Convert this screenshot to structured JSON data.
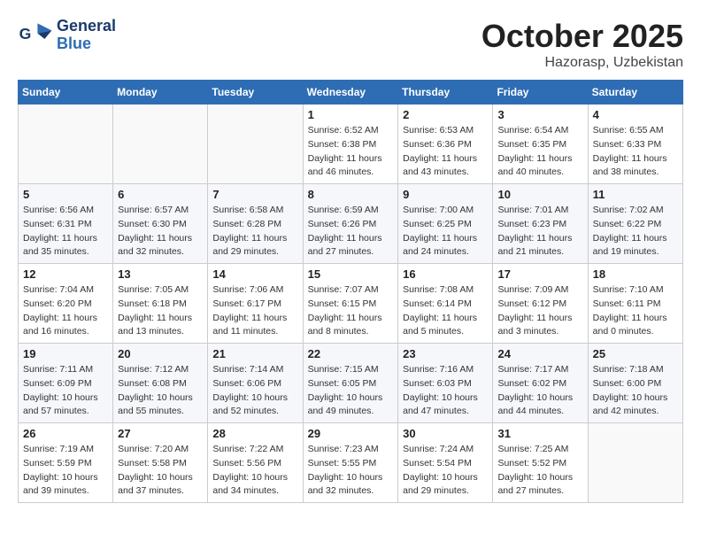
{
  "header": {
    "logo_general": "General",
    "logo_blue": "Blue",
    "month": "October 2025",
    "location": "Hazorasp, Uzbekistan"
  },
  "weekdays": [
    "Sunday",
    "Monday",
    "Tuesday",
    "Wednesday",
    "Thursday",
    "Friday",
    "Saturday"
  ],
  "weeks": [
    [
      {
        "day": "",
        "info": ""
      },
      {
        "day": "",
        "info": ""
      },
      {
        "day": "",
        "info": ""
      },
      {
        "day": "1",
        "info": "Sunrise: 6:52 AM\nSunset: 6:38 PM\nDaylight: 11 hours\nand 46 minutes."
      },
      {
        "day": "2",
        "info": "Sunrise: 6:53 AM\nSunset: 6:36 PM\nDaylight: 11 hours\nand 43 minutes."
      },
      {
        "day": "3",
        "info": "Sunrise: 6:54 AM\nSunset: 6:35 PM\nDaylight: 11 hours\nand 40 minutes."
      },
      {
        "day": "4",
        "info": "Sunrise: 6:55 AM\nSunset: 6:33 PM\nDaylight: 11 hours\nand 38 minutes."
      }
    ],
    [
      {
        "day": "5",
        "info": "Sunrise: 6:56 AM\nSunset: 6:31 PM\nDaylight: 11 hours\nand 35 minutes."
      },
      {
        "day": "6",
        "info": "Sunrise: 6:57 AM\nSunset: 6:30 PM\nDaylight: 11 hours\nand 32 minutes."
      },
      {
        "day": "7",
        "info": "Sunrise: 6:58 AM\nSunset: 6:28 PM\nDaylight: 11 hours\nand 29 minutes."
      },
      {
        "day": "8",
        "info": "Sunrise: 6:59 AM\nSunset: 6:26 PM\nDaylight: 11 hours\nand 27 minutes."
      },
      {
        "day": "9",
        "info": "Sunrise: 7:00 AM\nSunset: 6:25 PM\nDaylight: 11 hours\nand 24 minutes."
      },
      {
        "day": "10",
        "info": "Sunrise: 7:01 AM\nSunset: 6:23 PM\nDaylight: 11 hours\nand 21 minutes."
      },
      {
        "day": "11",
        "info": "Sunrise: 7:02 AM\nSunset: 6:22 PM\nDaylight: 11 hours\nand 19 minutes."
      }
    ],
    [
      {
        "day": "12",
        "info": "Sunrise: 7:04 AM\nSunset: 6:20 PM\nDaylight: 11 hours\nand 16 minutes."
      },
      {
        "day": "13",
        "info": "Sunrise: 7:05 AM\nSunset: 6:18 PM\nDaylight: 11 hours\nand 13 minutes."
      },
      {
        "day": "14",
        "info": "Sunrise: 7:06 AM\nSunset: 6:17 PM\nDaylight: 11 hours\nand 11 minutes."
      },
      {
        "day": "15",
        "info": "Sunrise: 7:07 AM\nSunset: 6:15 PM\nDaylight: 11 hours\nand 8 minutes."
      },
      {
        "day": "16",
        "info": "Sunrise: 7:08 AM\nSunset: 6:14 PM\nDaylight: 11 hours\nand 5 minutes."
      },
      {
        "day": "17",
        "info": "Sunrise: 7:09 AM\nSunset: 6:12 PM\nDaylight: 11 hours\nand 3 minutes."
      },
      {
        "day": "18",
        "info": "Sunrise: 7:10 AM\nSunset: 6:11 PM\nDaylight: 11 hours\nand 0 minutes."
      }
    ],
    [
      {
        "day": "19",
        "info": "Sunrise: 7:11 AM\nSunset: 6:09 PM\nDaylight: 10 hours\nand 57 minutes."
      },
      {
        "day": "20",
        "info": "Sunrise: 7:12 AM\nSunset: 6:08 PM\nDaylight: 10 hours\nand 55 minutes."
      },
      {
        "day": "21",
        "info": "Sunrise: 7:14 AM\nSunset: 6:06 PM\nDaylight: 10 hours\nand 52 minutes."
      },
      {
        "day": "22",
        "info": "Sunrise: 7:15 AM\nSunset: 6:05 PM\nDaylight: 10 hours\nand 49 minutes."
      },
      {
        "day": "23",
        "info": "Sunrise: 7:16 AM\nSunset: 6:03 PM\nDaylight: 10 hours\nand 47 minutes."
      },
      {
        "day": "24",
        "info": "Sunrise: 7:17 AM\nSunset: 6:02 PM\nDaylight: 10 hours\nand 44 minutes."
      },
      {
        "day": "25",
        "info": "Sunrise: 7:18 AM\nSunset: 6:00 PM\nDaylight: 10 hours\nand 42 minutes."
      }
    ],
    [
      {
        "day": "26",
        "info": "Sunrise: 7:19 AM\nSunset: 5:59 PM\nDaylight: 10 hours\nand 39 minutes."
      },
      {
        "day": "27",
        "info": "Sunrise: 7:20 AM\nSunset: 5:58 PM\nDaylight: 10 hours\nand 37 minutes."
      },
      {
        "day": "28",
        "info": "Sunrise: 7:22 AM\nSunset: 5:56 PM\nDaylight: 10 hours\nand 34 minutes."
      },
      {
        "day": "29",
        "info": "Sunrise: 7:23 AM\nSunset: 5:55 PM\nDaylight: 10 hours\nand 32 minutes."
      },
      {
        "day": "30",
        "info": "Sunrise: 7:24 AM\nSunset: 5:54 PM\nDaylight: 10 hours\nand 29 minutes."
      },
      {
        "day": "31",
        "info": "Sunrise: 7:25 AM\nSunset: 5:52 PM\nDaylight: 10 hours\nand 27 minutes."
      },
      {
        "day": "",
        "info": ""
      }
    ]
  ]
}
